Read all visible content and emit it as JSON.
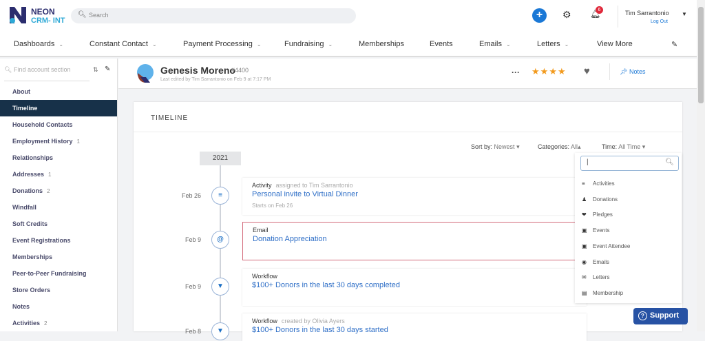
{
  "header": {
    "brand_line1": "NEON",
    "brand_line2": "CRM- INT",
    "search_placeholder": "Search",
    "notification_count": "6",
    "user_name": "Tim Sarrantonio",
    "logout": "Log Out"
  },
  "nav": [
    {
      "label": "Dashboards",
      "dropdown": true
    },
    {
      "label": "Constant Contact",
      "dropdown": true
    },
    {
      "label": "Payment Processing",
      "dropdown": true
    },
    {
      "label": "Fundraising",
      "dropdown": true
    },
    {
      "label": "Memberships"
    },
    {
      "label": "Events"
    },
    {
      "label": "Emails",
      "dropdown": true
    },
    {
      "label": "Letters",
      "dropdown": true
    },
    {
      "label": "View More"
    }
  ],
  "sidebar": {
    "find_placeholder": "Find account section",
    "items": [
      {
        "label": "About",
        "count": ""
      },
      {
        "label": "Timeline",
        "count": "",
        "active": true
      },
      {
        "label": "Household Contacts",
        "count": ""
      },
      {
        "label": "Employment History",
        "count": "1"
      },
      {
        "label": "Relationships",
        "count": ""
      },
      {
        "label": "Addresses",
        "count": "1"
      },
      {
        "label": "Donations",
        "count": "2"
      },
      {
        "label": "Windfall",
        "count": ""
      },
      {
        "label": "Soft Credits",
        "count": ""
      },
      {
        "label": "Event Registrations",
        "count": ""
      },
      {
        "label": "Memberships",
        "count": ""
      },
      {
        "label": "Peer-to-Peer Fundraising",
        "count": ""
      },
      {
        "label": "Store Orders",
        "count": ""
      },
      {
        "label": "Notes",
        "count": ""
      },
      {
        "label": "Activities",
        "count": "2"
      }
    ]
  },
  "profile": {
    "name": "Genesis Moreno",
    "id": "#4400",
    "last_edited": "Last edited by Tim Sarrantonio on Feb 9 at 7:17 PM",
    "rating": 4,
    "notes_label": "Notes"
  },
  "timeline": {
    "title": "TIMELINE",
    "sort_label": "Sort by:",
    "sort_value": "Newest",
    "categories_label": "Categories:",
    "categories_value": "All",
    "time_label": "Time:",
    "time_value": "All Time",
    "year": "2021",
    "items": [
      {
        "date": "Feb 26",
        "type": "Activity",
        "meta": "assigned to Tim Sarrantonio",
        "title": "Personal invite to Virtual Dinner",
        "sub": "Starts on Feb 26",
        "icon": "chart-icon"
      },
      {
        "date": "Feb 9",
        "type": "Email",
        "meta": "",
        "title": "Donation Appreciation",
        "sub": "",
        "icon": "at-icon"
      },
      {
        "date": "Feb 9",
        "type": "Workflow",
        "meta": "",
        "title": "$100+ Donors in the last 30 days completed",
        "sub": "",
        "icon": "filter-icon"
      },
      {
        "date": "Feb 8",
        "type": "Workflow",
        "meta": "created by Olivia Ayers",
        "title": "$100+ Donors in the last 30 days started",
        "sub": "",
        "icon": "filter-icon"
      }
    ]
  },
  "category_dropdown": {
    "search_value": "|",
    "options": [
      "Activities",
      "Donations",
      "Pledges",
      "Events",
      "Event Attendee",
      "Emails",
      "Letters",
      "Membership"
    ]
  },
  "support": {
    "label": "Support"
  },
  "colors": {
    "accent": "#1a78d6",
    "sidebar_active": "#173149",
    "support": "#2752a4",
    "star": "#f29a1d"
  }
}
